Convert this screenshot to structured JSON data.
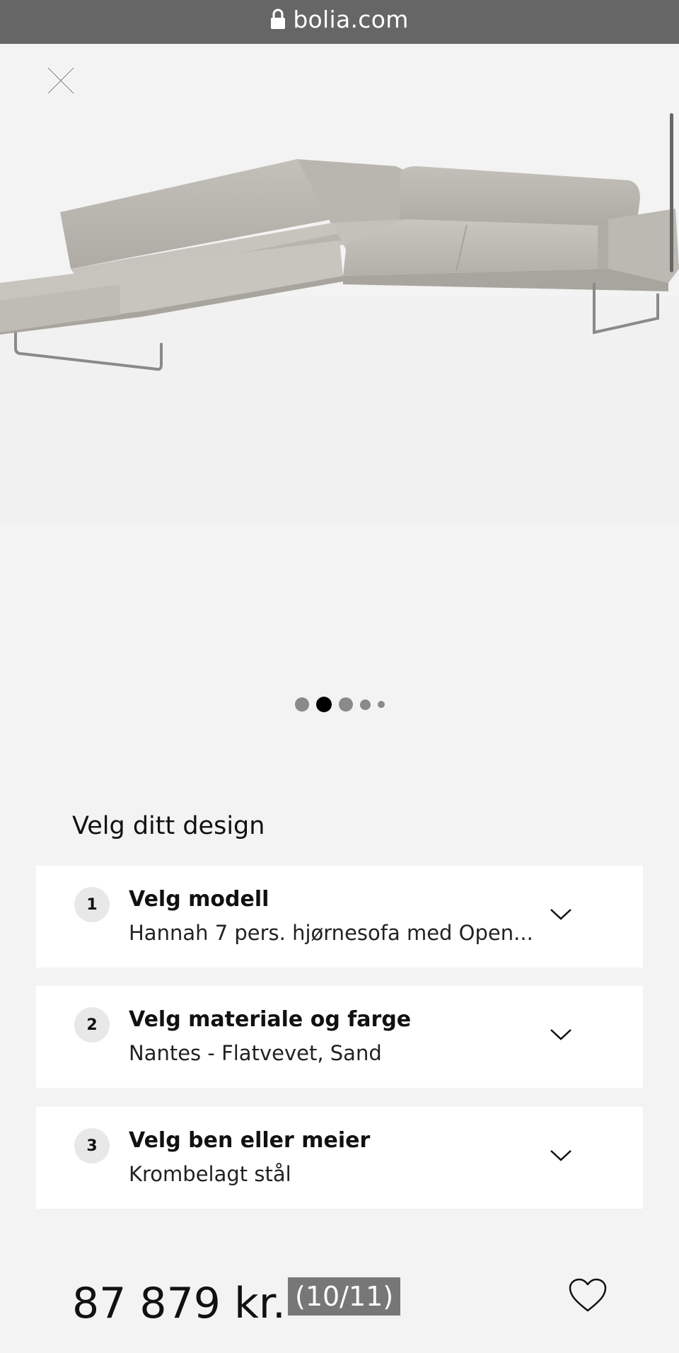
{
  "browser": {
    "url": "bolia.com",
    "lock_icon": "lock-icon"
  },
  "gallery": {
    "close_icon": "close-icon",
    "image_alt": "Grey corner sofa with chrome sled legs",
    "active_dot_index": 1,
    "dots_count": 5
  },
  "design": {
    "section_title": "Velg ditt design",
    "steps": [
      {
        "number": "1",
        "title": "Velg modell",
        "value": "Hannah 7 pers. hjørnesofa med Open..."
      },
      {
        "number": "2",
        "title": "Velg materiale og farge",
        "value": "Nantes - Flatvevet, Sand"
      },
      {
        "number": "3",
        "title": "Velg ben eller meier",
        "value": "Krombelagt stål"
      }
    ]
  },
  "footer": {
    "price": "87 879 kr.",
    "counter": "(10/11)",
    "favorite_icon": "heart-icon"
  },
  "colors": {
    "background": "#f3f3f3",
    "urlbar": "#666666",
    "sofa": "#bfbcb5",
    "active_dot": "#000000"
  }
}
